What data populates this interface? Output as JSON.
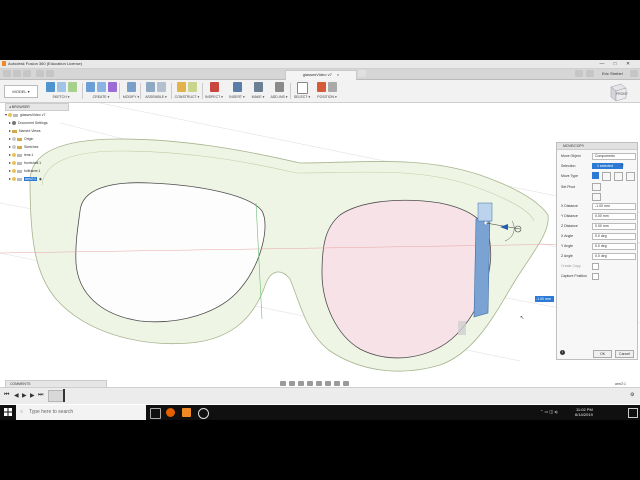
{
  "window": {
    "title": "Autodesk Fusion 360 (Education License)",
    "minimize": "—",
    "maximize": "□",
    "close": "✕"
  },
  "tab": {
    "label": "glassesVideo v7"
  },
  "user": {
    "name": "Eric Strebel"
  },
  "toolbar": {
    "mode": "MODEL",
    "groups": [
      {
        "label": "SKETCH ▾"
      },
      {
        "label": "CREATE ▾"
      },
      {
        "label": "MODIFY ▾"
      },
      {
        "label": "ASSEMBLE ▾"
      },
      {
        "label": "CONSTRUCT ▾"
      },
      {
        "label": "INSPECT ▾"
      },
      {
        "label": "INSERT ▾"
      },
      {
        "label": "MAKE ▾"
      },
      {
        "label": "ADD-INS ▾"
      },
      {
        "label": "SELECT ▾"
      },
      {
        "label": "POSITION ▾"
      }
    ]
  },
  "viewcube": {
    "label": "FRONT"
  },
  "browser": {
    "header": "BROWSER",
    "items": [
      {
        "label": "glassesVideo v7"
      },
      {
        "label": "Document Settings"
      },
      {
        "label": "Named Views"
      },
      {
        "label": "Origin"
      },
      {
        "label": "Sketches"
      },
      {
        "label": "lens:1"
      },
      {
        "label": "frontshell:1"
      },
      {
        "label": "fullframe:1"
      },
      {
        "label": "arm2:1"
      }
    ]
  },
  "move_panel": {
    "header": "MOVE/COPY",
    "rows": [
      {
        "label": "Move Object",
        "value": "Components"
      },
      {
        "label": "Selection",
        "value": "1 selected"
      },
      {
        "label": "Move Type",
        "value": ""
      },
      {
        "label": "Set Pivot",
        "value": ""
      },
      {
        "label": "X Distance",
        "value": "-1.00 mm"
      },
      {
        "label": "Y Distance",
        "value": "0.00 mm"
      },
      {
        "label": "Z Distance",
        "value": "0.00 mm"
      },
      {
        "label": "X Angle",
        "value": "0.0 deg"
      },
      {
        "label": "Y Angle",
        "value": "0.0 deg"
      },
      {
        "label": "Z Angle",
        "value": "0.0 deg"
      },
      {
        "label": "Create Copy",
        "value": ""
      },
      {
        "label": "Capture Position",
        "value": ""
      }
    ],
    "ok": "OK",
    "cancel": "Cancel"
  },
  "manipulator": {
    "value": "-1.00 mm"
  },
  "comments": {
    "label": "COMMENTS"
  },
  "status_right": "arm2:1",
  "taskbar": {
    "search_placeholder": "Type here to search",
    "time": "11:02 PM",
    "date": "6/14/2019"
  },
  "colors": {
    "accent": "#2b7bd6",
    "frame_fill": "#e9f3dc",
    "frame_stroke": "#a7b48f",
    "lens_fill": "#f6e1e6",
    "arm_blue": "#7aa3d4"
  }
}
